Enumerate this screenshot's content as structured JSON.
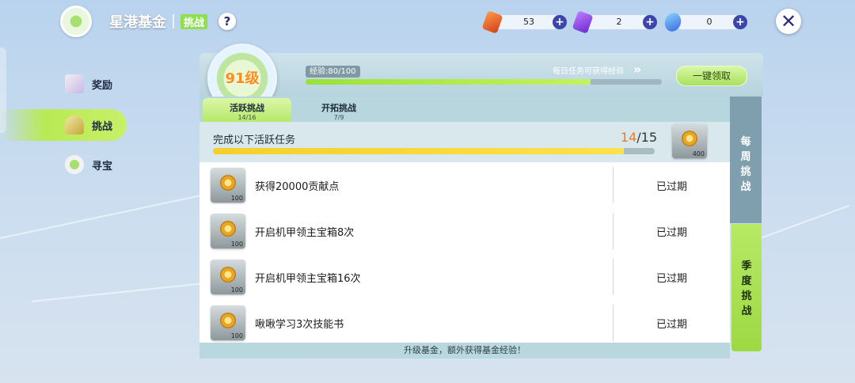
{
  "header": {
    "title": "星港基金",
    "tag": "挑战",
    "help": "?"
  },
  "currencies": [
    {
      "icon": "ticket-icon",
      "value": "53",
      "plus": "+"
    },
    {
      "icon": "purple-card-icon",
      "value": "2",
      "plus": "+"
    },
    {
      "icon": "blue-crystal-icon",
      "value": "0",
      "plus": "+"
    }
  ],
  "close_label": "✕",
  "sidebar": {
    "items": [
      {
        "label": "奖励",
        "icon": "gift-icon"
      },
      {
        "label": "挑战",
        "icon": "trophy-icon"
      },
      {
        "label": "寻宝",
        "icon": "coin-stack-icon"
      }
    ]
  },
  "level": {
    "text": "91级",
    "exp_label": "经验:80/100",
    "exp_current": 80,
    "exp_max": 100,
    "daily_hint": "每日任务可获得经验",
    "claim_all": "一键领取"
  },
  "tabs": [
    {
      "name": "活跃挑战",
      "count": "14/16"
    },
    {
      "name": "开拓挑战",
      "count": "7/9"
    }
  ],
  "summary": {
    "label": "完成以下活跃任务",
    "current": "14",
    "total": "/15",
    "progress": 0.93,
    "reward_qty": "400"
  },
  "tasks": [
    {
      "text": "获得20000贡献点",
      "status": "已过期",
      "reward_qty": "100"
    },
    {
      "text": "开启机甲领主宝箱8次",
      "status": "已过期",
      "reward_qty": "100"
    },
    {
      "text": "开启机甲领主宝箱16次",
      "status": "已过期",
      "reward_qty": "100"
    },
    {
      "text": "啾啾学习3次技能书",
      "status": "已过期",
      "reward_qty": "100"
    }
  ],
  "footer": "升级基金，额外获得基金经验！",
  "right_tabs": {
    "weekly": "每周挑战",
    "season": "季度挑战"
  },
  "colors": {
    "accent_green": "#b8ea55",
    "exp_fill": "#9ae23a",
    "progress_yellow": "#f4cf2c",
    "level_orange": "#ff8c1a",
    "count_orange": "#f07a1e"
  }
}
